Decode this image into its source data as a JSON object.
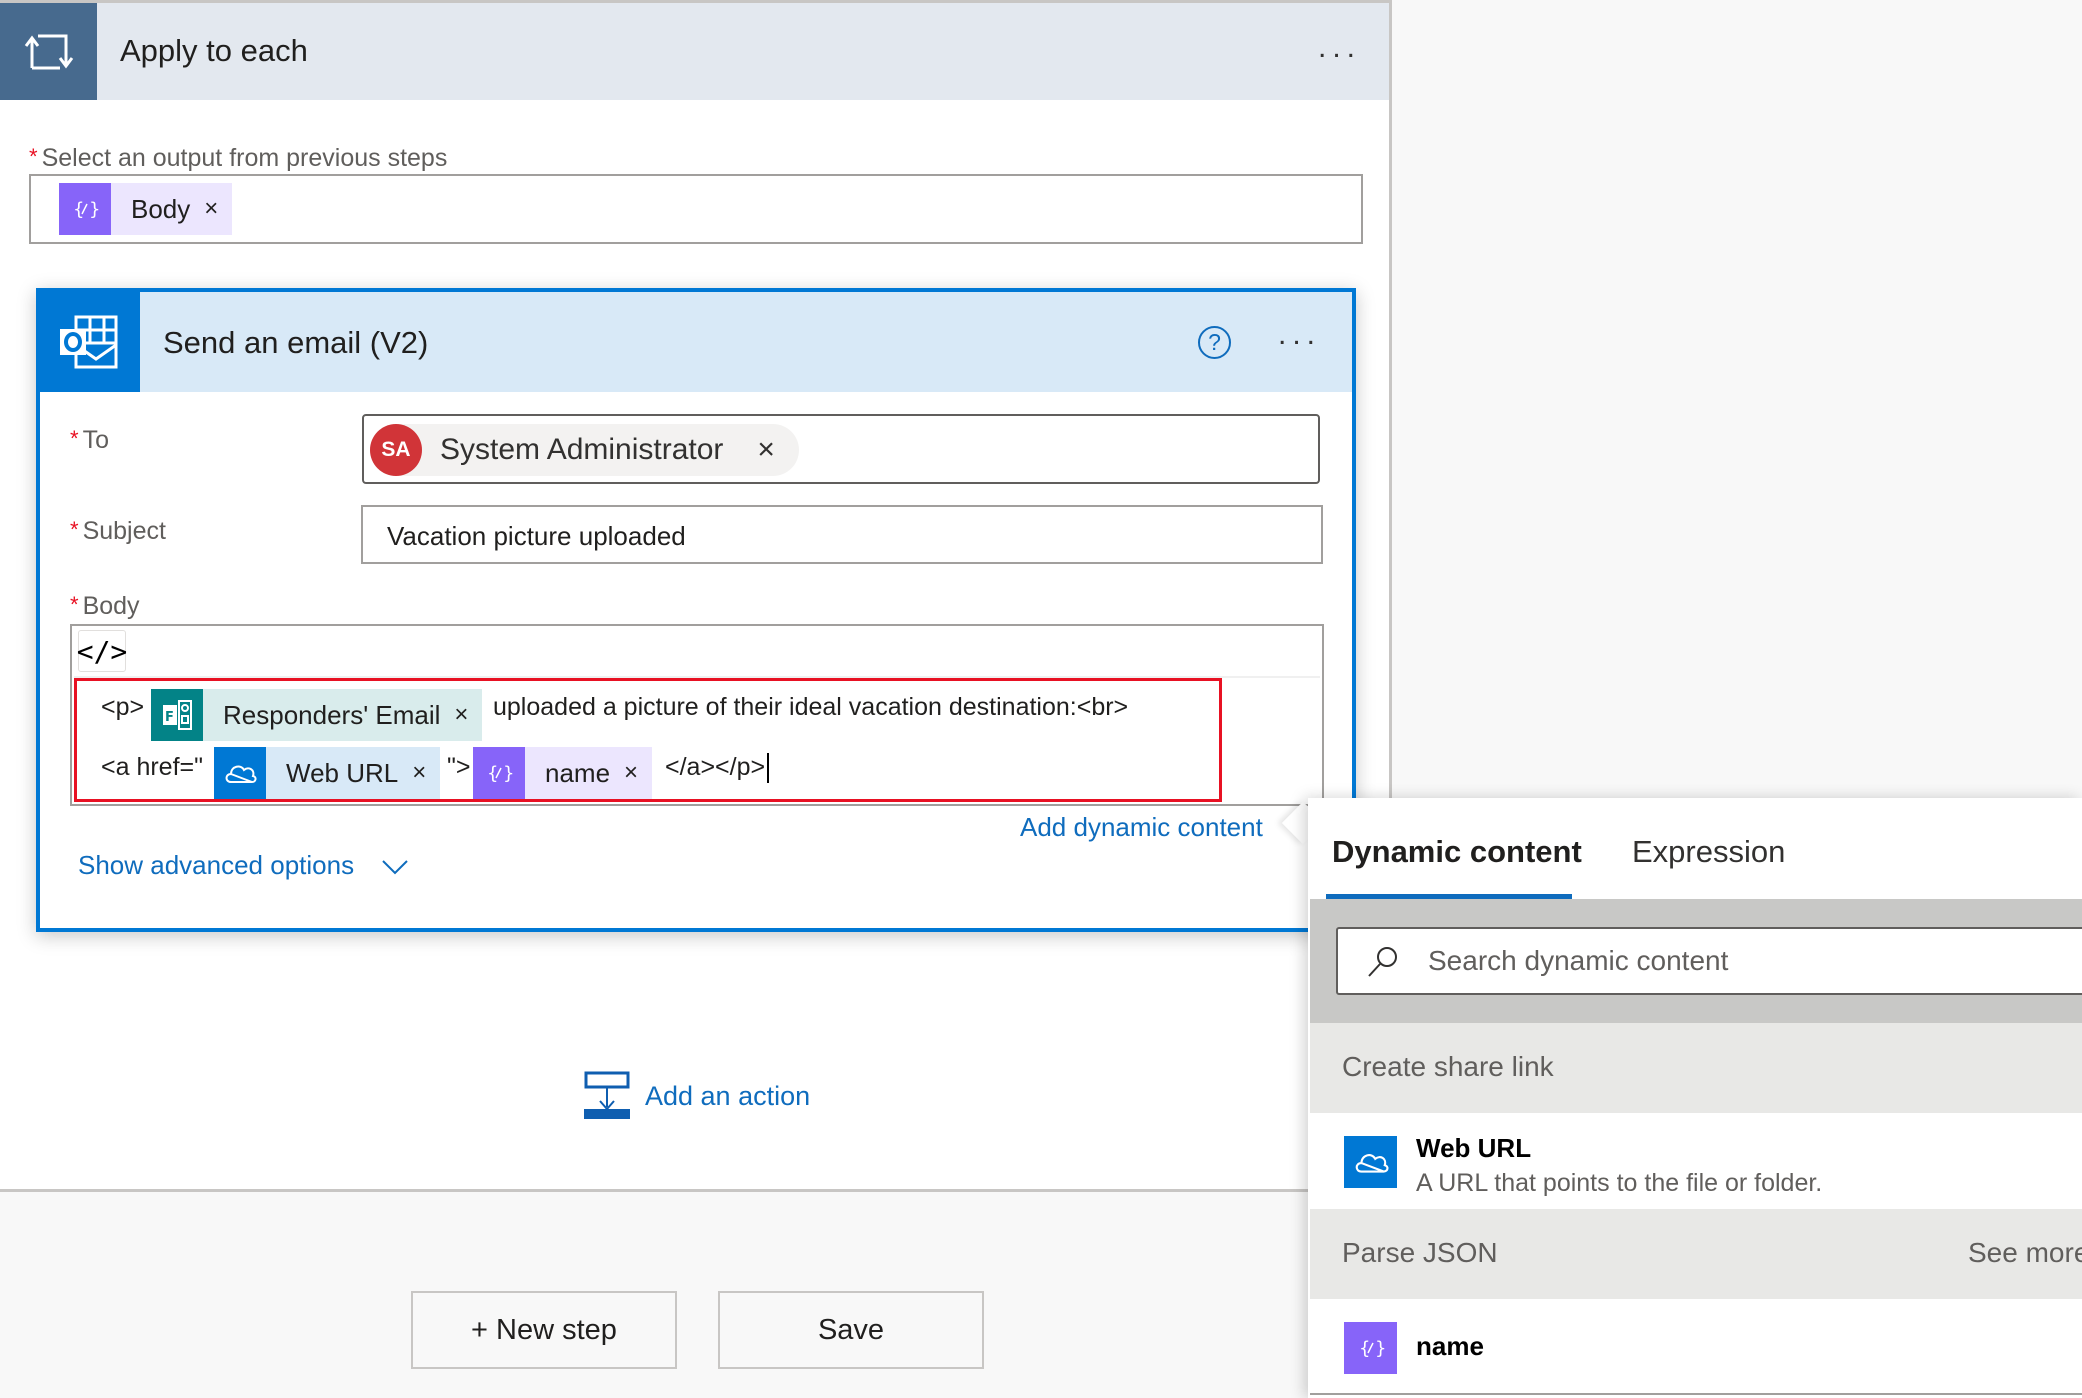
{
  "apply_to_each": {
    "title": "Apply to each",
    "more_label": "...",
    "output_label": "Select an output from previous steps",
    "required_mark": "*",
    "output_token": {
      "label": "Body",
      "remove": "×",
      "icon": "expression-icon"
    }
  },
  "send_email": {
    "title": "Send an email (V2)",
    "help_label": "?",
    "more_label": "...",
    "fields": {
      "to_label": "To",
      "to_recipient": {
        "initials": "SA",
        "name": "System Administrator",
        "remove": "×"
      },
      "subject_label": "Subject",
      "subject_value": "Vacation picture uploaded",
      "body_label": "Body",
      "code_view_label": "</>"
    },
    "body_content": {
      "line1_prefix": "<p>",
      "token_responders": {
        "label": "Responders' Email",
        "remove": "×",
        "icon": "forms-icon"
      },
      "line1_suffix": "uploaded a picture of their ideal vacation destination:<br>",
      "line2_prefix": "<a href=\"",
      "token_weburl": {
        "label": "Web URL",
        "remove": "×",
        "icon": "onedrive-icon"
      },
      "line2_mid": "\">",
      "token_name": {
        "label": "name",
        "remove": "×",
        "icon": "expression-icon"
      },
      "line2_suffix": "</a></p>"
    },
    "add_dynamic_content": "Add dynamic content",
    "show_advanced": "Show advanced options"
  },
  "add_action": "Add an action",
  "buttons": {
    "new_step": "+ New step",
    "save": "Save"
  },
  "dynamic_panel": {
    "tabs": [
      {
        "label": "Dynamic content",
        "active": true
      },
      {
        "label": "Expression",
        "active": false
      }
    ],
    "search_placeholder": "Search dynamic content",
    "sections": [
      {
        "header": "Create share link",
        "see_more": "",
        "items": [
          {
            "title": "Web URL",
            "description": "A URL that points to the file or folder.",
            "icon": "onedrive-icon"
          }
        ]
      },
      {
        "header": "Parse JSON",
        "see_more": "See more",
        "items": [
          {
            "title": "name",
            "description": "",
            "icon": "expression-icon"
          }
        ]
      }
    ]
  },
  "colors": {
    "accent_blue": "#0078d4",
    "link_blue": "#0f6cbd",
    "expression_purple": "#8764f9",
    "forms_teal": "#038387",
    "required_red": "#e81123",
    "avatar_red": "#d13438",
    "loop_header": "#476a8e"
  }
}
